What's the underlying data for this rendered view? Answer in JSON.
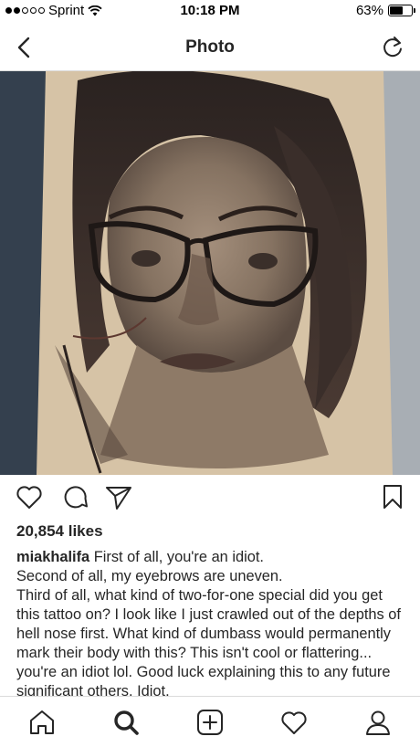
{
  "status_bar": {
    "carrier": "Sprint",
    "time": "10:18 PM",
    "battery": "63%",
    "battery_level": 0.63,
    "signal_bars_filled": 2,
    "signal_bars_total": 5
  },
  "nav": {
    "title": "Photo",
    "back_icon": "chevron-left-icon",
    "refresh_icon": "refresh-icon"
  },
  "post": {
    "image_description_icon": "photo",
    "likes": "20,854 likes",
    "username": "miakhalifa",
    "caption_lines": [
      "First of all, you're an idiot.",
      "Second of all, my eyebrows are uneven.",
      "Third of all, what kind of two-for-one special did you get this tattoo on? I look like I just crawled out of the depths of hell nose first. What kind of dumbass would permanently mark their body with this? This isn't cool or flattering... you're an idiot lol. Good luck explaining this to any future significant others. Idiot."
    ]
  },
  "tabs": [
    "home-icon",
    "search-icon",
    "add-post-icon",
    "activity-heart-icon",
    "profile-icon"
  ],
  "colors": {
    "text": "#262626",
    "divider": "#dbdbdb"
  }
}
